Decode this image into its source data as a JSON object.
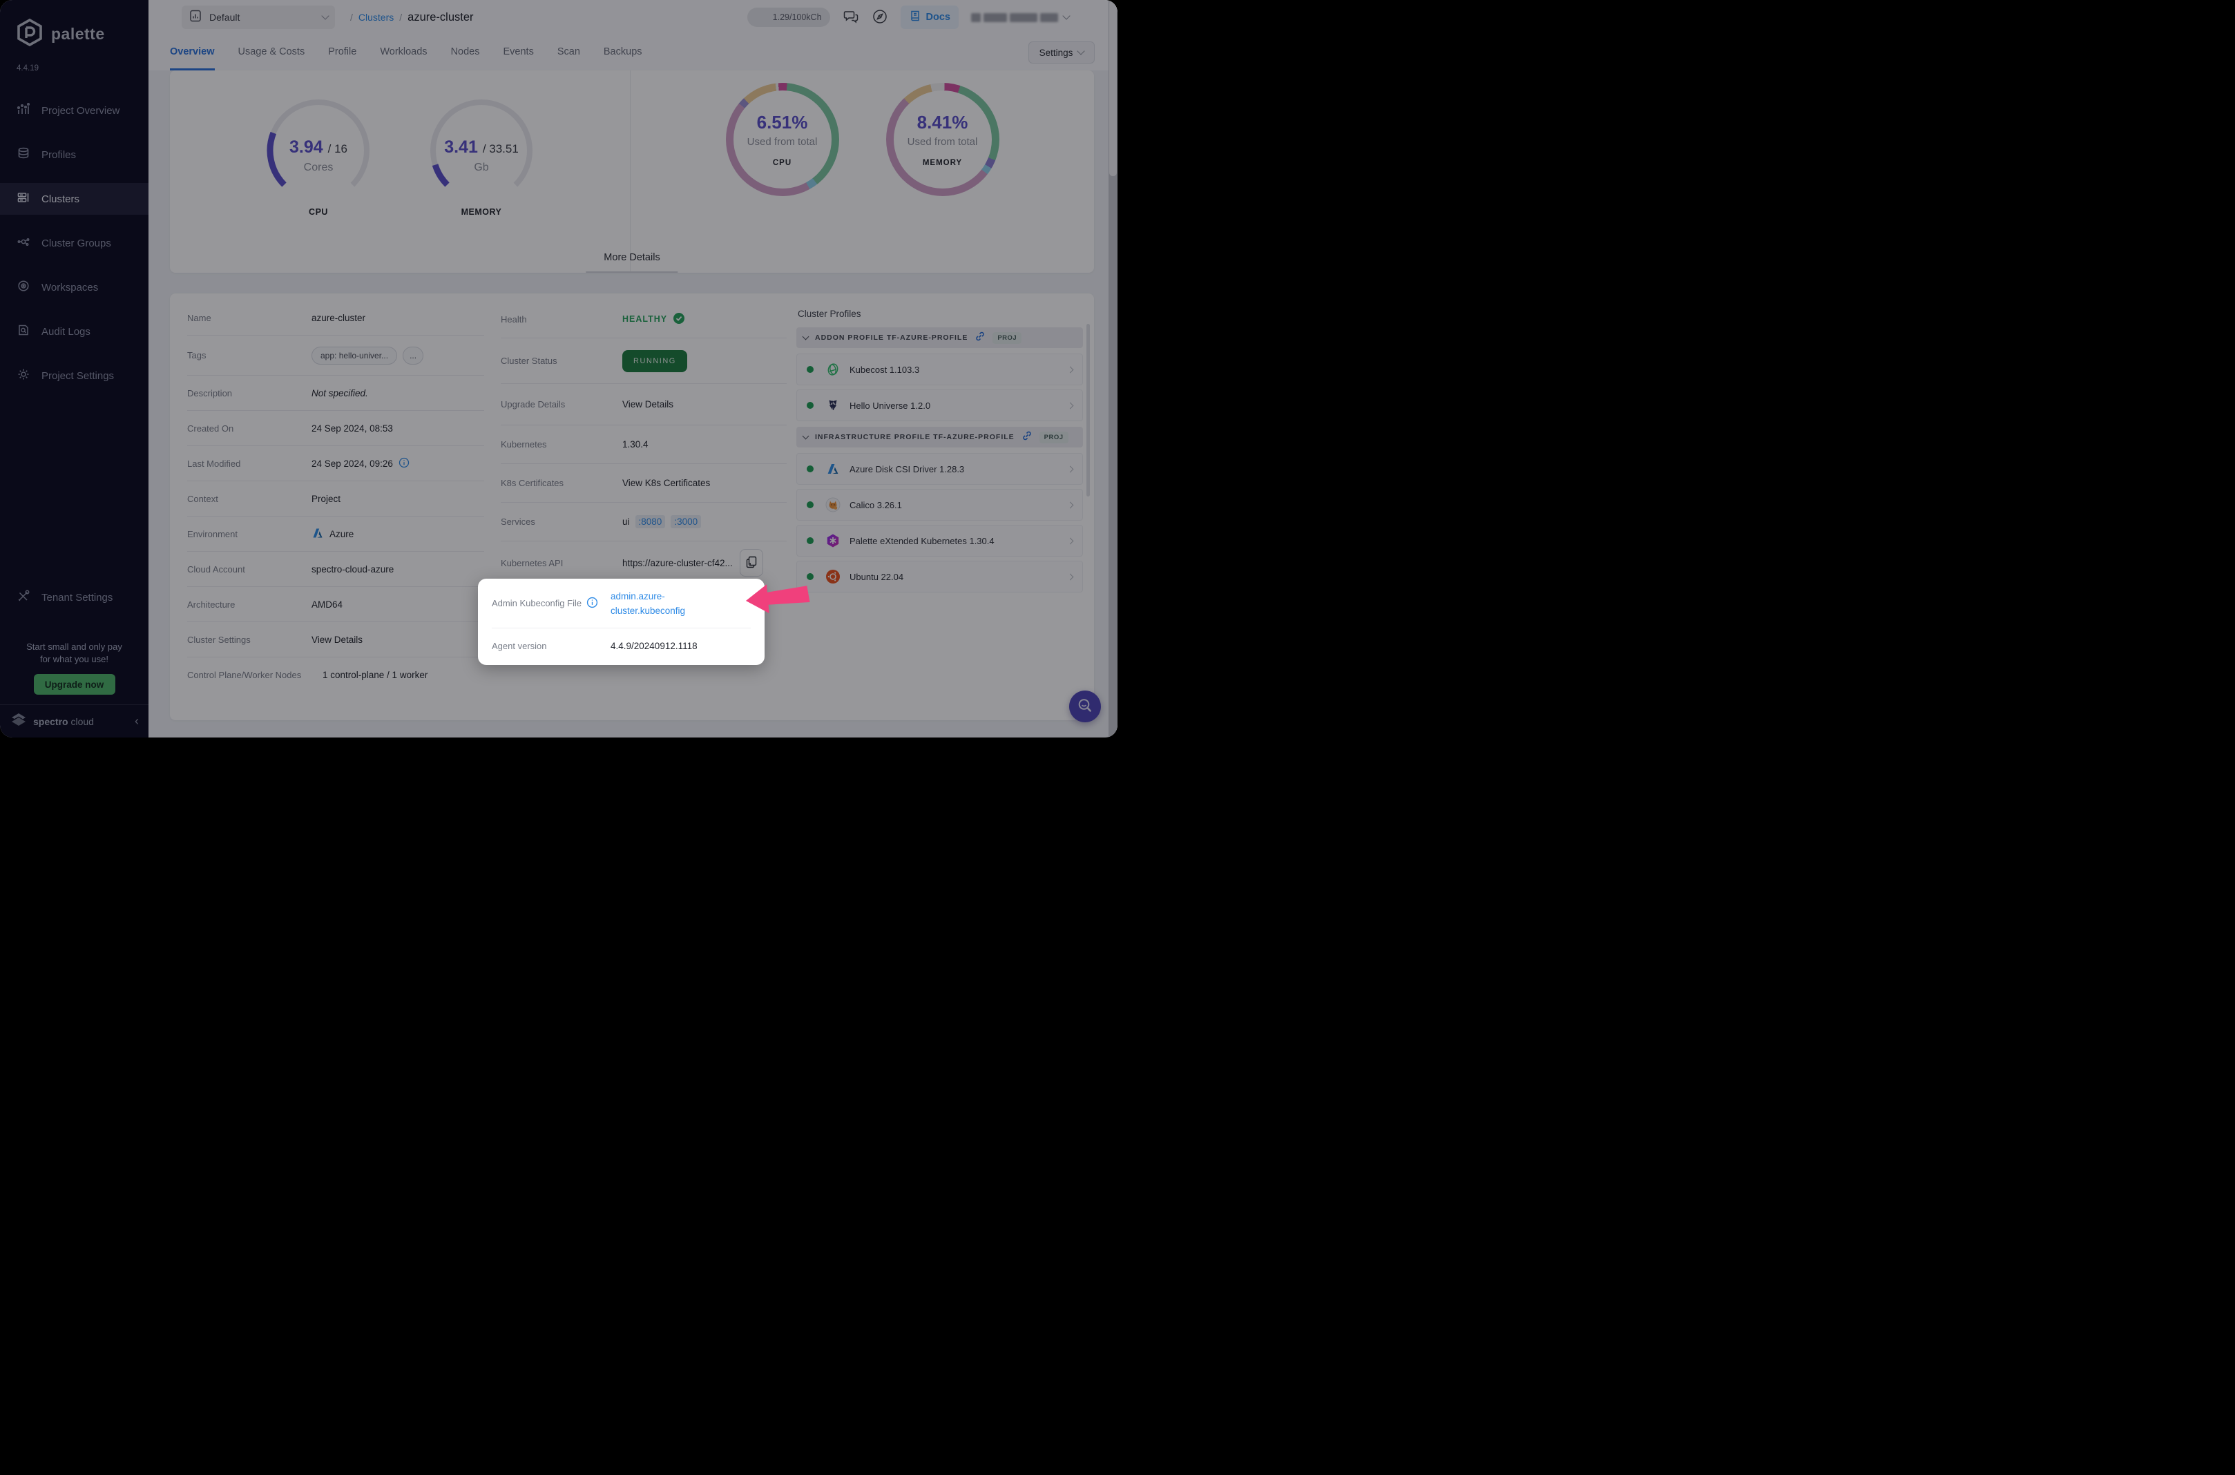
{
  "colors": {
    "accent_blue": "#2f8be6",
    "healthy_green": "#27a35c",
    "running_green": "#1e7c40",
    "gauge_purple": "#5a50c8",
    "arrow_pink": "#f0407c",
    "sidebar_bg": "#0d0d22"
  },
  "sidebar": {
    "brand": "palette",
    "version": "4.4.19",
    "items": [
      {
        "label": "Project Overview"
      },
      {
        "label": "Profiles"
      },
      {
        "label": "Clusters"
      },
      {
        "label": "Cluster Groups"
      },
      {
        "label": "Workspaces"
      },
      {
        "label": "Audit Logs"
      },
      {
        "label": "Project Settings"
      }
    ],
    "active": "Clusters",
    "tenant": "Tenant Settings",
    "promo_line1": "Start small and only pay",
    "promo_line2": "for what you use!",
    "upgrade": "Upgrade now",
    "footer_brand_1": "spectro",
    "footer_brand_2": " cloud"
  },
  "topbar": {
    "project": "Default",
    "separator": "/",
    "breadcrumb_link": "Clusters",
    "breadcrumb_current": "azure-cluster",
    "credits": "1.29/100kCh",
    "docs": "Docs"
  },
  "tabs": {
    "items": [
      "Overview",
      "Usage & Costs",
      "Profile",
      "Workloads",
      "Nodes",
      "Events",
      "Scan",
      "Backups"
    ],
    "active": "Overview",
    "settings": "Settings"
  },
  "metrics": {
    "cpu_gauge": {
      "used": "3.94",
      "total": "/ 16",
      "unit": "Cores",
      "label": "CPU",
      "used_value": 3.94,
      "total_value": 16
    },
    "memory_gauge": {
      "used": "3.41",
      "total": "/ 33.51",
      "unit": "Gb",
      "label": "MEMORY",
      "used_value": 3.41,
      "total_value": 33.51
    },
    "cpu_donut": {
      "pct": "6.51%",
      "caption": "Used from total",
      "label": "CPU",
      "pct_value": 6.51
    },
    "memory_donut": {
      "pct": "8.41%",
      "caption": "Used from total",
      "label": "MEMORY",
      "pct_value": 8.41
    },
    "more_details": "More Details"
  },
  "details": {
    "left": [
      {
        "label": "Name",
        "value": "azure-cluster"
      },
      {
        "label": "Tags",
        "tag1": "app: hello-univer...",
        "tag2": "..."
      },
      {
        "label": "Description",
        "value": "Not specified."
      },
      {
        "label": "Created On",
        "value": "24 Sep 2024, 08:53"
      },
      {
        "label": "Last Modified",
        "value": "24 Sep 2024, 09:26"
      },
      {
        "label": "Context",
        "value": "Project"
      },
      {
        "label": "Environment",
        "value": "Azure"
      },
      {
        "label": "Cloud Account",
        "value": "spectro-cloud-azure"
      },
      {
        "label": "Architecture",
        "value": "AMD64"
      },
      {
        "label": "Cluster Settings",
        "link": "View Details"
      },
      {
        "label": "Control Plane/Worker Nodes",
        "value": "1 control-plane / 1 worker"
      }
    ],
    "middle": [
      {
        "label": "Health",
        "status": "HEALTHY"
      },
      {
        "label": "Cluster Status",
        "badge": "RUNNING"
      },
      {
        "label": "Upgrade Details",
        "link": "View Details"
      },
      {
        "label": "Kubernetes",
        "value": "1.30.4"
      },
      {
        "label": "K8s Certificates",
        "link": "View K8s Certificates"
      },
      {
        "label": "Services",
        "service": "ui",
        "port1": ":8080",
        "port2": ":3000"
      },
      {
        "label": "Kubernetes API",
        "value": "https://azure-cluster-cf42..."
      }
    ]
  },
  "spotlight": {
    "label": "Admin Kubeconfig File",
    "link_line1": "admin.azure-",
    "link_line2": "cluster.kubeconfig",
    "agent_label": "Agent version",
    "agent_value": "4.4.9/20240912.1118"
  },
  "profiles": {
    "title": "Cluster Profiles",
    "sections": [
      {
        "title": "ADDON PROFILE TF-AZURE-PROFILE",
        "badge": "PROJ",
        "items": [
          {
            "name": "Kubecost 1.103.3"
          },
          {
            "name": "Hello Universe 1.2.0"
          }
        ]
      },
      {
        "title": "INFRASTRUCTURE PROFILE TF-AZURE-PROFILE",
        "badge": "PROJ",
        "items": [
          {
            "name": "Azure Disk CSI Driver 1.28.3"
          },
          {
            "name": "Calico 3.26.1"
          },
          {
            "name": "Palette eXtended Kubernetes 1.30.4"
          },
          {
            "name": "Ubuntu 22.04"
          }
        ]
      }
    ]
  }
}
